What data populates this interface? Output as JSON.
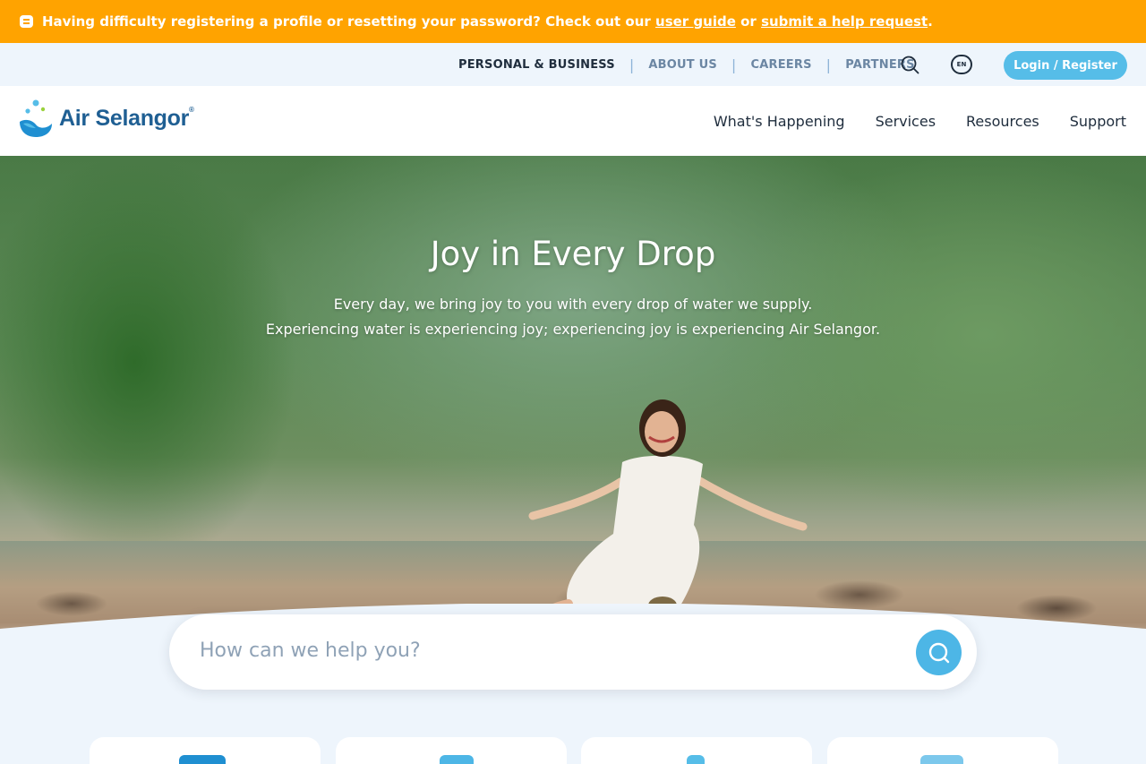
{
  "alert": {
    "text_before": "Having difficulty registering a profile or resetting your password? Check out our ",
    "link1": "user guide",
    "text_mid": " or ",
    "link2": "submit a help request",
    "text_after": "."
  },
  "utility_nav": {
    "items": [
      "PERSONAL & BUSINESS",
      "ABOUT US",
      "CAREERS",
      "PARTNERS"
    ],
    "active_item": "PERSONAL & BUSINESS",
    "language": "EN",
    "login_label": "Login / Register"
  },
  "brand": {
    "name": "Air Selangor",
    "trademark": "®"
  },
  "main_nav": {
    "items": [
      "What's Happening",
      "Services",
      "Resources",
      "Support"
    ]
  },
  "hero": {
    "title": "Joy in Every Drop",
    "subtitle_line1": "Every day, we bring joy to you with every drop of water we supply.",
    "subtitle_line2": "Experiencing water is experiencing joy; experiencing joy is experiencing Air Selangor."
  },
  "search": {
    "placeholder": "How can we help you?"
  },
  "colors": {
    "alert_bg": "#ffa300",
    "accent": "#56bde8",
    "brand_blue": "#1f5f93",
    "page_bg": "#eef5fc"
  },
  "icons": [
    "chat-icon",
    "search-icon",
    "language-icon",
    "logo-drop-icon",
    "search-button-icon"
  ]
}
